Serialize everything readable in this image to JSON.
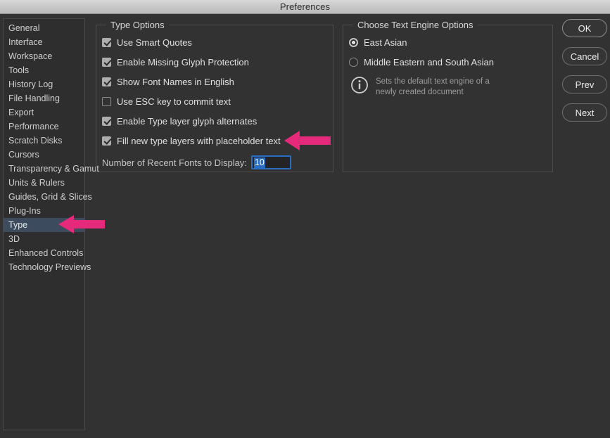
{
  "window": {
    "title": "Preferences"
  },
  "sidebar": {
    "items": [
      {
        "label": "General",
        "selected": false
      },
      {
        "label": "Interface",
        "selected": false
      },
      {
        "label": "Workspace",
        "selected": false
      },
      {
        "label": "Tools",
        "selected": false
      },
      {
        "label": "History Log",
        "selected": false
      },
      {
        "label": "File Handling",
        "selected": false
      },
      {
        "label": "Export",
        "selected": false
      },
      {
        "label": "Performance",
        "selected": false
      },
      {
        "label": "Scratch Disks",
        "selected": false
      },
      {
        "label": "Cursors",
        "selected": false
      },
      {
        "label": "Transparency & Gamut",
        "selected": false
      },
      {
        "label": "Units & Rulers",
        "selected": false
      },
      {
        "label": "Guides, Grid & Slices",
        "selected": false
      },
      {
        "label": "Plug-Ins",
        "selected": false
      },
      {
        "label": "Type",
        "selected": true
      },
      {
        "label": "3D",
        "selected": false
      },
      {
        "label": "Enhanced Controls",
        "selected": false
      },
      {
        "label": "Technology Previews",
        "selected": false
      }
    ]
  },
  "type_options": {
    "legend": "Type Options",
    "checkboxes": [
      {
        "label": "Use Smart Quotes",
        "checked": true
      },
      {
        "label": "Enable Missing Glyph Protection",
        "checked": true
      },
      {
        "label": "Show Font Names in English",
        "checked": true
      },
      {
        "label": "Use ESC key to commit text",
        "checked": false
      },
      {
        "label": "Enable Type layer glyph alternates",
        "checked": true
      },
      {
        "label": "Fill new type layers with placeholder text",
        "checked": true
      }
    ],
    "recent_fonts": {
      "label": "Number of Recent Fonts to Display:",
      "value": "10"
    }
  },
  "text_engine_options": {
    "legend": "Choose Text Engine Options",
    "radios": [
      {
        "label": "East Asian",
        "selected": true
      },
      {
        "label": "Middle Eastern and South Asian",
        "selected": false
      }
    ],
    "hint": {
      "icon": "info-icon",
      "line1": "Sets the default text engine of a",
      "line2": "newly created document"
    }
  },
  "buttons": [
    {
      "label": "OK",
      "primary": true
    },
    {
      "label": "Cancel",
      "primary": false
    },
    {
      "label": "Prev",
      "primary": false
    },
    {
      "label": "Next",
      "primary": false
    }
  ],
  "annotations": {
    "color": "#e62a7b",
    "arrows": [
      {
        "name": "arrow-pointing-fill-placeholder-text"
      },
      {
        "name": "arrow-pointing-type-sidebar-item"
      }
    ]
  }
}
